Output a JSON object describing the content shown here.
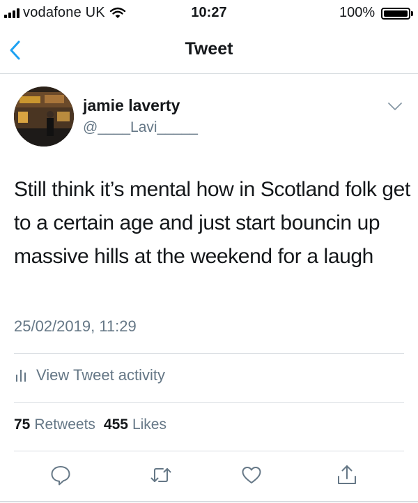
{
  "status_bar": {
    "carrier": "vodafone UK",
    "time": "10:27",
    "battery": "100%"
  },
  "nav": {
    "title": "Tweet",
    "back_icon": "chevron-left-icon"
  },
  "tweet": {
    "author_name": "jamie laverty",
    "author_handle": "@____Lavi_____",
    "text": "Still think it’s mental how in Scotland folk get to a certain age and just start bouncin up massive hills at the weekend for a laugh",
    "timestamp": "25/02/2019, 11:29",
    "activity_label": "View Tweet activity",
    "retweets_count": "75",
    "retweets_label": "Retweets",
    "likes_count": "455",
    "likes_label": "Likes"
  },
  "actions": [
    "reply-icon",
    "retweet-icon",
    "like-icon",
    "share-icon"
  ],
  "colors": {
    "accent": "#1da1f2",
    "text": "#14171a",
    "secondary": "#657786",
    "icon": "#657786",
    "divider": "#d8dde1"
  }
}
